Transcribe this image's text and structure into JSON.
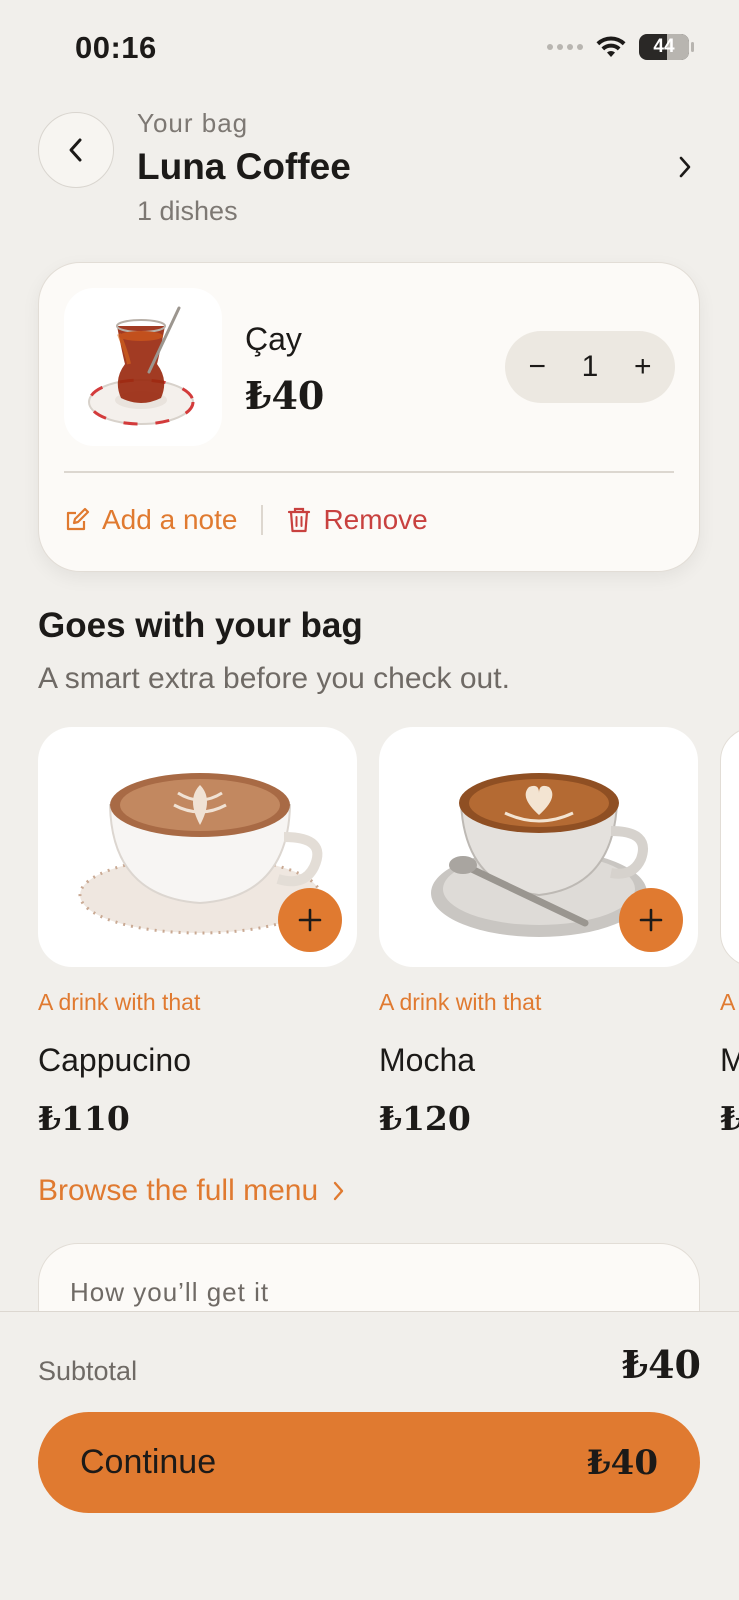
{
  "status_bar": {
    "time": "00:16",
    "battery": "44"
  },
  "header": {
    "subtitle": "Your bag",
    "title": "Luna Coffee",
    "count": "1 dishes"
  },
  "bag_item": {
    "name": "Çay",
    "price": "₺40",
    "quantity": "1",
    "decrement": "−",
    "increment": "+",
    "note_label": "Add a note",
    "remove_label": "Remove"
  },
  "recommendations": {
    "title": "Goes with your bag",
    "subtitle": "A smart extra before you check out.",
    "items": [
      {
        "tag": "A drink with that",
        "name": "Cappucino",
        "price": "₺110"
      },
      {
        "tag": "A drink with that",
        "name": "Mocha",
        "price": "₺120"
      },
      {
        "tag": "A",
        "name": "M",
        "price": "₺"
      }
    ],
    "browse_label": "Browse the full menu"
  },
  "fulfillment": {
    "label": "How you’ll get it"
  },
  "footer": {
    "subtotal_label": "Subtotal",
    "subtotal_value": "₺40",
    "continue_label": "Continue",
    "continue_price": "₺40"
  },
  "colors": {
    "accent": "#e07a30",
    "danger": "#c8413f",
    "background": "#f1efeb",
    "card": "#fcfaf7"
  }
}
